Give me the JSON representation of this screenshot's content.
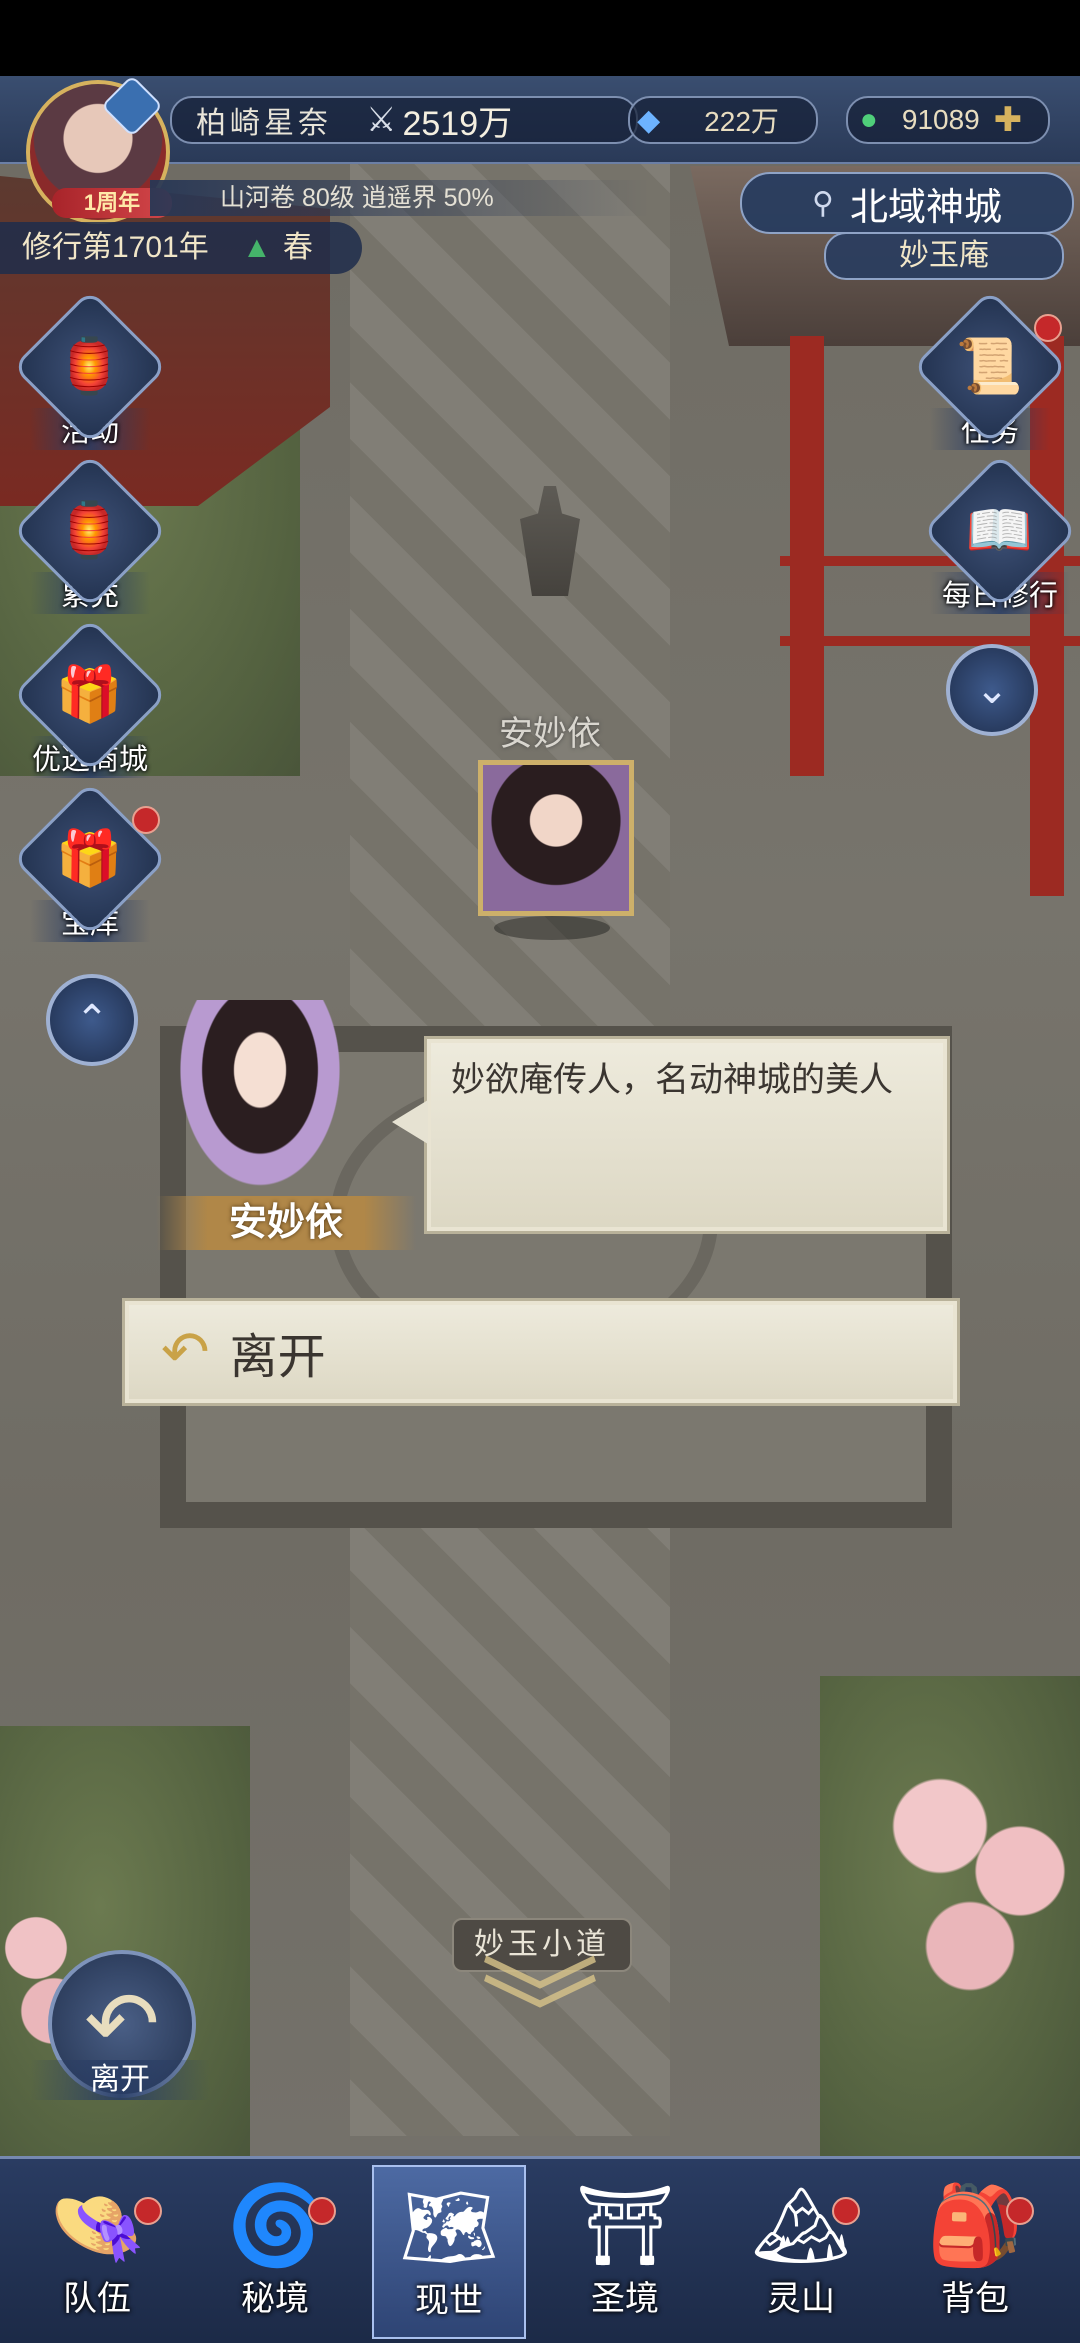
{
  "player": {
    "name": "柏崎星奈",
    "power": "2519万",
    "anniversary_badge": "1周年",
    "realm": "山河卷 80级 逍遥界 50%",
    "cultivation_year": "修行第1701年",
    "season": "春"
  },
  "currency": {
    "spirit_crystal": "222万",
    "jade": "91089"
  },
  "location": {
    "region": "北域神城",
    "place": "妙玉庵",
    "path_sign": "妙玉小道"
  },
  "left_menu": [
    {
      "label": "活动",
      "icon": "activity-icon",
      "badge": false
    },
    {
      "label": "累充",
      "icon": "lantern-icon",
      "badge": false
    },
    {
      "label": "优选商城",
      "icon": "shop-chest-icon",
      "badge": false
    },
    {
      "label": "宝库",
      "icon": "treasure-chest-icon",
      "badge": true
    }
  ],
  "right_menu": [
    {
      "label": "任务",
      "icon": "scroll-icon",
      "badge": true
    },
    {
      "label": "每日修行",
      "icon": "book-icon",
      "badge": false
    }
  ],
  "npc": {
    "name": "安妙依",
    "dialogue": "妙欲庵传人，名动神城的美人",
    "option_leave": "离开"
  },
  "exit_button": "离开",
  "bottom_nav": [
    {
      "label": "队伍",
      "icon": "team-hat-icon",
      "badge": true,
      "active": false
    },
    {
      "label": "秘境",
      "icon": "vortex-icon",
      "badge": true,
      "active": false
    },
    {
      "label": "现世",
      "icon": "world-map-icon",
      "badge": false,
      "active": true
    },
    {
      "label": "圣境",
      "icon": "temple-icon",
      "badge": false,
      "active": false
    },
    {
      "label": "灵山",
      "icon": "mountain-icon",
      "badge": true,
      "active": false
    },
    {
      "label": "背包",
      "icon": "bag-icon",
      "badge": true,
      "active": false
    }
  ],
  "colors": {
    "hud_blue": "#2a3a58",
    "gold": "#e6c77a",
    "badge_red": "#c5282a",
    "dialog_bg": "#eeebdd"
  }
}
